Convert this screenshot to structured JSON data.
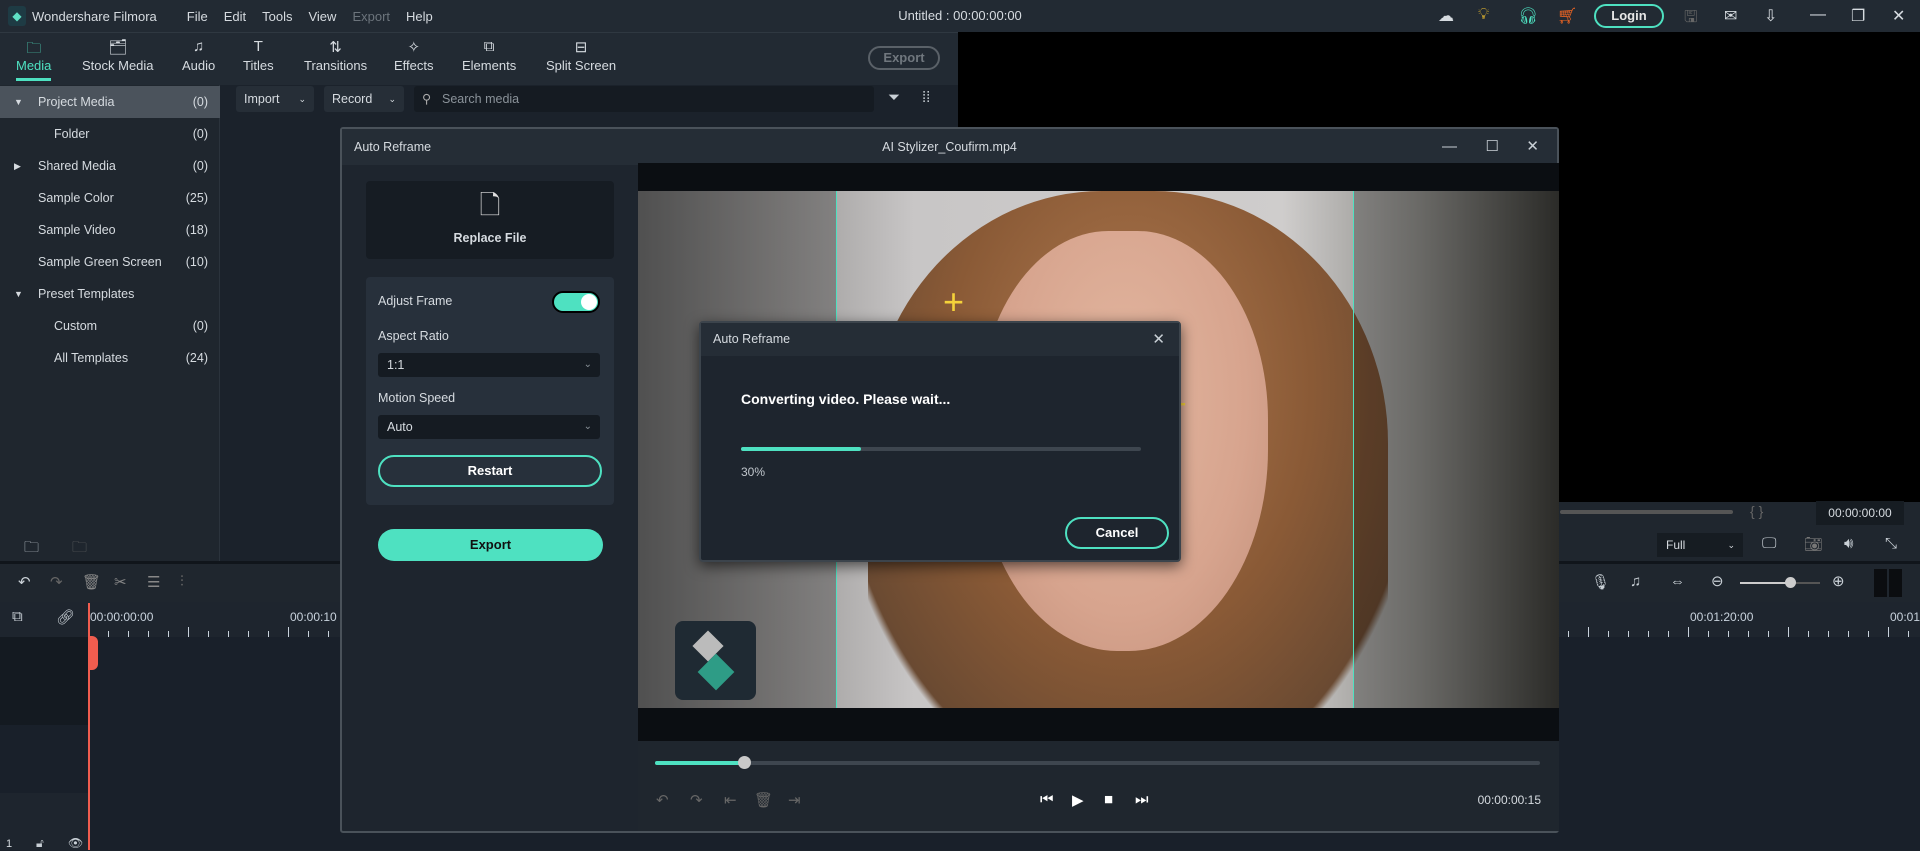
{
  "app": {
    "name": "Wondershare Filmora",
    "project_title": "Untitled : 00:00:00:00",
    "menu": [
      "File",
      "Edit",
      "Tools",
      "View",
      "Export",
      "Help"
    ],
    "login_label": "Login",
    "accent": "#4ee1c1"
  },
  "tabs": [
    {
      "label": "Media",
      "icon": "folder-icon",
      "active": true
    },
    {
      "label": "Stock Media",
      "icon": "stock-icon"
    },
    {
      "label": "Audio",
      "icon": "music-icon"
    },
    {
      "label": "Titles",
      "icon": "text-icon"
    },
    {
      "label": "Transitions",
      "icon": "transition-icon"
    },
    {
      "label": "Effects",
      "icon": "effects-icon"
    },
    {
      "label": "Elements",
      "icon": "elements-icon"
    },
    {
      "label": "Split Screen",
      "icon": "split-screen-icon"
    }
  ],
  "export_label": "Export",
  "sidebar": {
    "items": [
      {
        "label": "Project Media",
        "count": "(0)"
      },
      {
        "label": "Folder",
        "count": "(0)"
      },
      {
        "label": "Shared Media",
        "count": "(0)"
      },
      {
        "label": "Sample Color",
        "count": "(25)"
      },
      {
        "label": "Sample Video",
        "count": "(18)"
      },
      {
        "label": "Sample Green Screen",
        "count": "(10)"
      },
      {
        "label": "Preset Templates",
        "count": ""
      },
      {
        "label": "Custom",
        "count": "(0)"
      },
      {
        "label": "All Templates",
        "count": "(24)"
      }
    ]
  },
  "media_bar": {
    "import": "Import",
    "record": "Record",
    "search_placeholder": "Search media"
  },
  "preview": {
    "timecode": "00:00:00:00",
    "quality": "Full",
    "brackets": "{   }"
  },
  "timeline": {
    "ruler": [
      "00:00:00:00",
      "00:00:10",
      "00:01:20:00",
      "00:01"
    ],
    "track_num": "1"
  },
  "reframe": {
    "title": "Auto Reframe",
    "file": "AI Stylizer_Coufirm.mp4",
    "replace_file": "Replace File",
    "adjust_frame": "Adjust Frame",
    "adjust_frame_on": true,
    "aspect_ratio_label": "Aspect Ratio",
    "aspect_ratio": "1:1",
    "motion_speed_label": "Motion Speed",
    "motion_speed": "Auto",
    "restart": "Restart",
    "export": "Export",
    "timecode": "00:00:00:15",
    "playback_progress": 0.1
  },
  "progress_dialog": {
    "title": "Auto Reframe",
    "message": "Converting video. Please wait...",
    "percent_label": "30%",
    "progress": 0.3,
    "cancel": "Cancel"
  }
}
